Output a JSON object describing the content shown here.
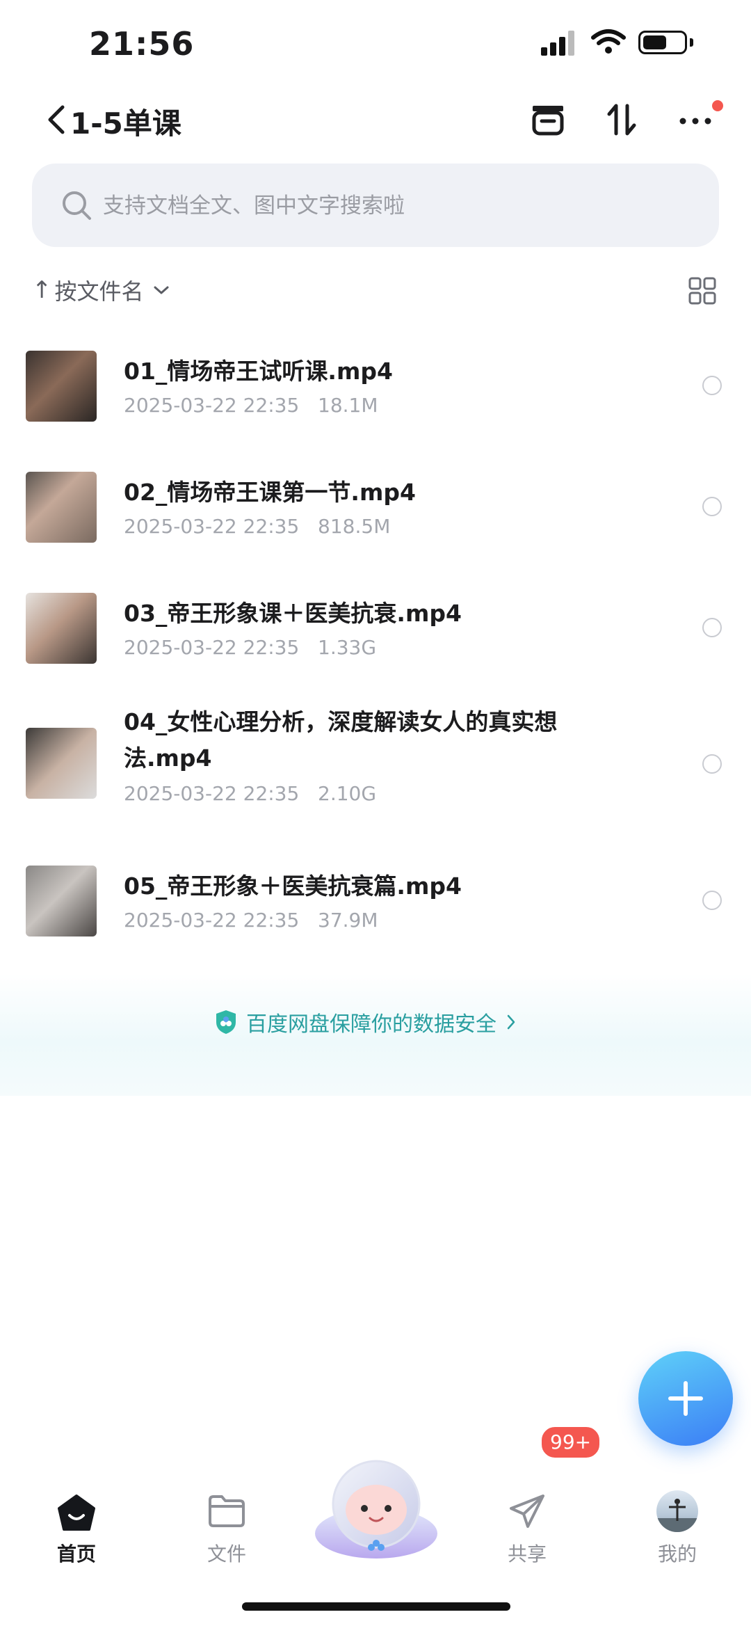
{
  "status_bar": {
    "time": "21:56"
  },
  "nav": {
    "title": "1-5单课"
  },
  "search": {
    "placeholder": "支持文档全文、图中文字搜索啦"
  },
  "sort": {
    "arrow": "↑",
    "label": "按文件名"
  },
  "files": [
    {
      "name": "01_情场帝王试听课.mp4",
      "date": "2025-03-22 22:35",
      "size": "18.1M"
    },
    {
      "name": "02_情场帝王课第一节.mp4",
      "date": "2025-03-22 22:35",
      "size": "818.5M"
    },
    {
      "name": "03_帝王形象课＋医美抗衰.mp4",
      "date": "2025-03-22 22:35",
      "size": "1.33G"
    },
    {
      "name": "04_女性心理分析，深度解读女人的真实想法.mp4",
      "date": "2025-03-22 22:35",
      "size": "2.10G"
    },
    {
      "name": "05_帝王形象＋医美抗衰篇.mp4",
      "date": "2025-03-22 22:35",
      "size": "37.9M"
    }
  ],
  "safety_banner": {
    "text": "百度网盘保障你的数据安全"
  },
  "tabs": {
    "home": "首页",
    "files": "文件",
    "share": "共享",
    "mine": "我的"
  },
  "share_badge": "99+",
  "colors": {
    "accent": "#3b7df6",
    "safety": "#2a9fa0",
    "badge": "#f4574f"
  }
}
